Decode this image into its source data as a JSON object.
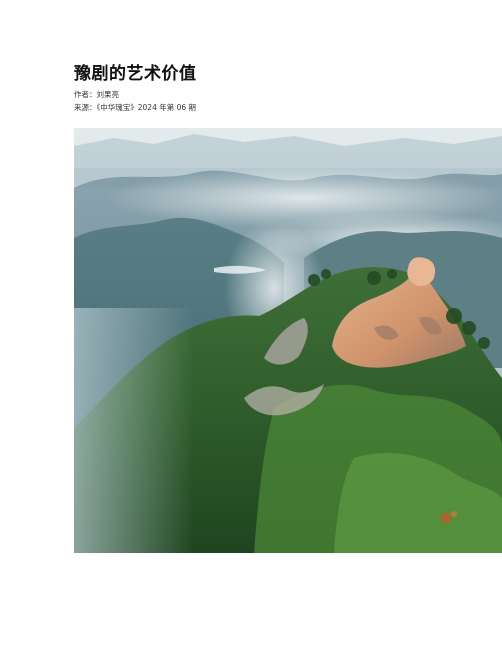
{
  "document": {
    "title": "豫剧的艺术价值",
    "author_line": "作者：刘果亮",
    "source_line": "来源：《中华瑰宝》2024 年第 06 期"
  },
  "photo": {
    "subject": "misty-mountain-peak-photo",
    "colors": {
      "sky": "#cfdde2",
      "far_mountains": "#7f9aa6",
      "mid_mountains": "#5d7f8a",
      "forest_dark": "#2f5a2c",
      "forest_light": "#5e9a3f",
      "rock_sunlit": "#d9a07a",
      "rock_shadow": "#9a8575"
    }
  }
}
